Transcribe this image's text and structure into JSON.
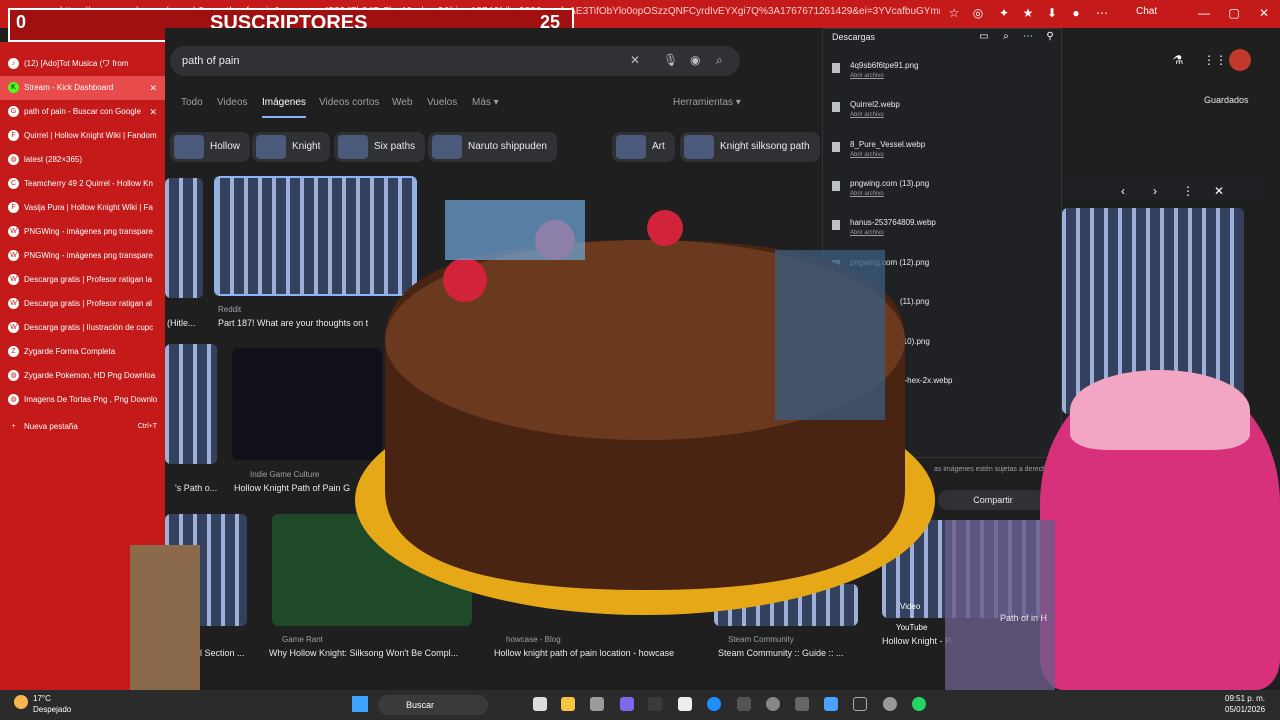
{
  "browser": {
    "url": "https://www.google.com/search?q=path+of+pain&sca_esv=453947b847c7ba4&udm=2&biw=1874&bih=988&sxsrf=AE3TifObYlo0opOSzzQNFCyrdIvEYXgi7Q%3A1767671261429&ei=3YVcafbuGYmmntkPtyqJ...",
    "chat_label": "Chat"
  },
  "counter": {
    "left": "0",
    "title": "SUSCRIPTORES",
    "right": "25"
  },
  "tabs": [
    {
      "label": "(12) [Ado]Tot Musica  (ワ from"
    },
    {
      "label": "Stream - Kick Dashboard"
    },
    {
      "label": "path of pain - Buscar con Google"
    },
    {
      "label": "Quirrel | Hollow Knight Wiki | Fandom"
    },
    {
      "label": "latest (282×365)"
    },
    {
      "label": "Teamcherry 49 2 Quirrel - Hollow Kn"
    },
    {
      "label": "Vasija Pura | Hollow Knight Wiki | Fa"
    },
    {
      "label": "PNGWing - imágenes png transpare"
    },
    {
      "label": "PNGWing - imágenes png transpare"
    },
    {
      "label": "Descarga gratis | Profesor ratigan la"
    },
    {
      "label": "Descarga gratis | Profesor ratigan al"
    },
    {
      "label": "Descarga gratis | Ilustración de cupc"
    },
    {
      "label": "Zygarde Forma Completa"
    },
    {
      "label": "Zygarde Pokemon, HD Png Downloa"
    },
    {
      "label": "Imagens De Tortas Png , Png Downlo"
    },
    {
      "label": "Nueva pestaña",
      "shortcut": "Ctrl+T"
    }
  ],
  "search": {
    "query": "path of pain"
  },
  "nav": {
    "items": [
      "Todo",
      "Videos",
      "Imágenes",
      "Videos cortos",
      "Web",
      "Vuelos",
      "Más ▾"
    ],
    "tools": "Herramientas ▾",
    "saved": "Guardados"
  },
  "chips": [
    "Hollow",
    "Knight",
    "Six paths",
    "Naruto shippuden",
    "Art",
    "Knight silksong path"
  ],
  "results": [
    {
      "source": "Reddit",
      "caption": "Part 187! What are your thoughts on t"
    },
    {
      "source": "Indie Game Culture",
      "caption": "Hollow Knight Path of Pain G"
    },
    {
      "source": "Game Rant",
      "caption": "Why Hollow Knight: Silksong Won't Be Compl..."
    },
    {
      "source": "howcase - Blog",
      "caption": "Hollow knight path of pain location - howcase"
    },
    {
      "source": "Steam Community",
      "caption": "Steam Community :: Guide :: ..."
    },
    {
      "source": "YouTube",
      "caption": "Hollow Knight - Pat"
    },
    {
      "left_caption_1": "(Hitle..."
    },
    {
      "left_caption_2": "'s Path o..."
    },
    {
      "left_caption_3": "nal Section ..."
    }
  ],
  "downloads": {
    "title": "Descargas",
    "open_label": "Abrir archivo",
    "files": [
      "4q9sb6f6tpe91.png",
      "Quirrel2.webp",
      "8_Pure_Vessel.webp",
      "pngwing.com (13).png",
      "hanus-253764809.webp",
      "pngwing.com (12).png",
      "(11).png",
      "(10).png",
      "o-hex-2x.webp"
    ],
    "note": "as imágenes estén sujetas a derech",
    "share": "Compartir",
    "video_label": "Video",
    "youtube": "YouTube"
  },
  "overlay": {
    "path_text": "Path of in H"
  },
  "taskbar": {
    "temp": "17°C",
    "weather": "Despejado",
    "search": "Buscar",
    "time": "09:51 p. m.",
    "date": "05/01/2026"
  }
}
